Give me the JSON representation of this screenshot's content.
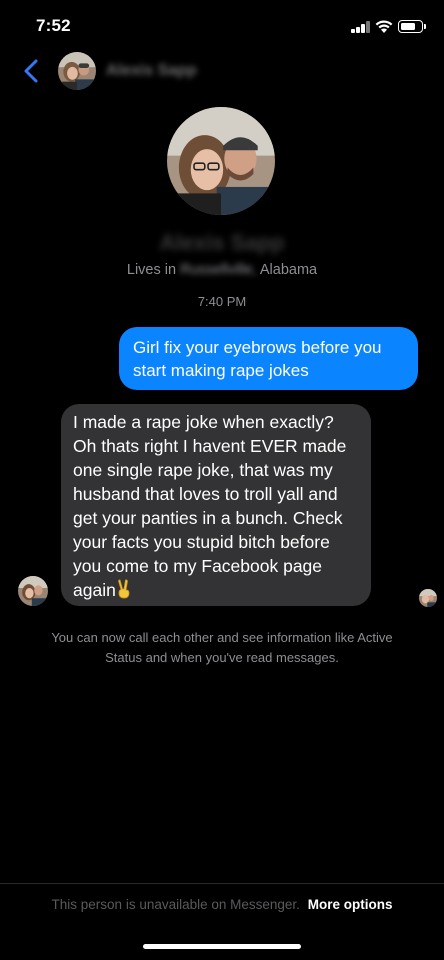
{
  "status_bar": {
    "time": "7:52",
    "icons": [
      "cellular-signal-icon",
      "wifi-icon",
      "battery-icon"
    ],
    "battery_level": 0.75
  },
  "header": {
    "back_icon": "chevron-left-icon",
    "contact_name": "Alexis Sapp",
    "accent_color": "#3478f6"
  },
  "profile": {
    "name": "Alexis Sapp",
    "location_prefix": "Lives in",
    "location_city": "Russellville,",
    "location_state": "Alabama"
  },
  "conversation": {
    "timestamp": "7:40 PM",
    "messages": [
      {
        "direction": "outgoing",
        "text": "Girl fix your eyebrows before you\nstart making rape jokes",
        "color": "#0a84ff"
      },
      {
        "direction": "incoming",
        "text": "I made a rape joke when exactly?\nOh thats right I havent EVER made\none single rape joke, that was my\nhusband that loves to troll yall and\nget your panties in a bunch. Check\nyour facts you stupid bitch before\nyou come to my Facebook page\nagain",
        "emoji": "victory-hand-emoji",
        "color": "#333336"
      }
    ],
    "info_note": "You can now call each other and see information like Active\nStatus and when you've read messages."
  },
  "footer": {
    "unavailable_text": "This person is unavailable on Messenger.",
    "more_options_label": "More options"
  }
}
